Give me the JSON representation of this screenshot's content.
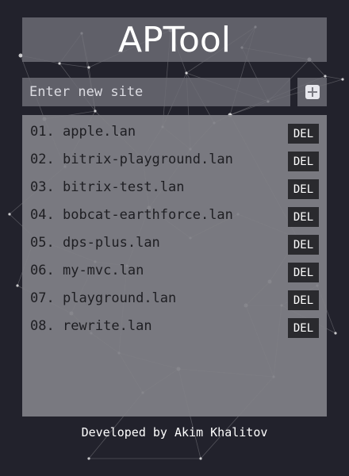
{
  "app": {
    "title": "APTool"
  },
  "input": {
    "placeholder": "Enter new site",
    "value": ""
  },
  "add_button": {
    "icon": "plus-square-icon"
  },
  "sites": [
    {
      "number": "01.",
      "name": "apple.lan",
      "delete_label": "DEL"
    },
    {
      "number": "02.",
      "name": "bitrix-playground.lan",
      "delete_label": "DEL"
    },
    {
      "number": "03.",
      "name": "bitrix-test.lan",
      "delete_label": "DEL"
    },
    {
      "number": "04.",
      "name": "bobcat-earthforce.lan",
      "delete_label": "DEL"
    },
    {
      "number": "05.",
      "name": "dps-plus.lan",
      "delete_label": "DEL"
    },
    {
      "number": "06.",
      "name": "my-mvc.lan",
      "delete_label": "DEL"
    },
    {
      "number": "07.",
      "name": "playground.lan",
      "delete_label": "DEL"
    },
    {
      "number": "08.",
      "name": "rewrite.lan",
      "delete_label": "DEL"
    }
  ],
  "footer": {
    "text": "Developed by Akim Khalitov"
  },
  "colors": {
    "background": "#22222c",
    "panel": "#808086",
    "button_dark": "#2a2a2e",
    "text_light": "#ffffff",
    "text_dark": "#1e1e22"
  }
}
